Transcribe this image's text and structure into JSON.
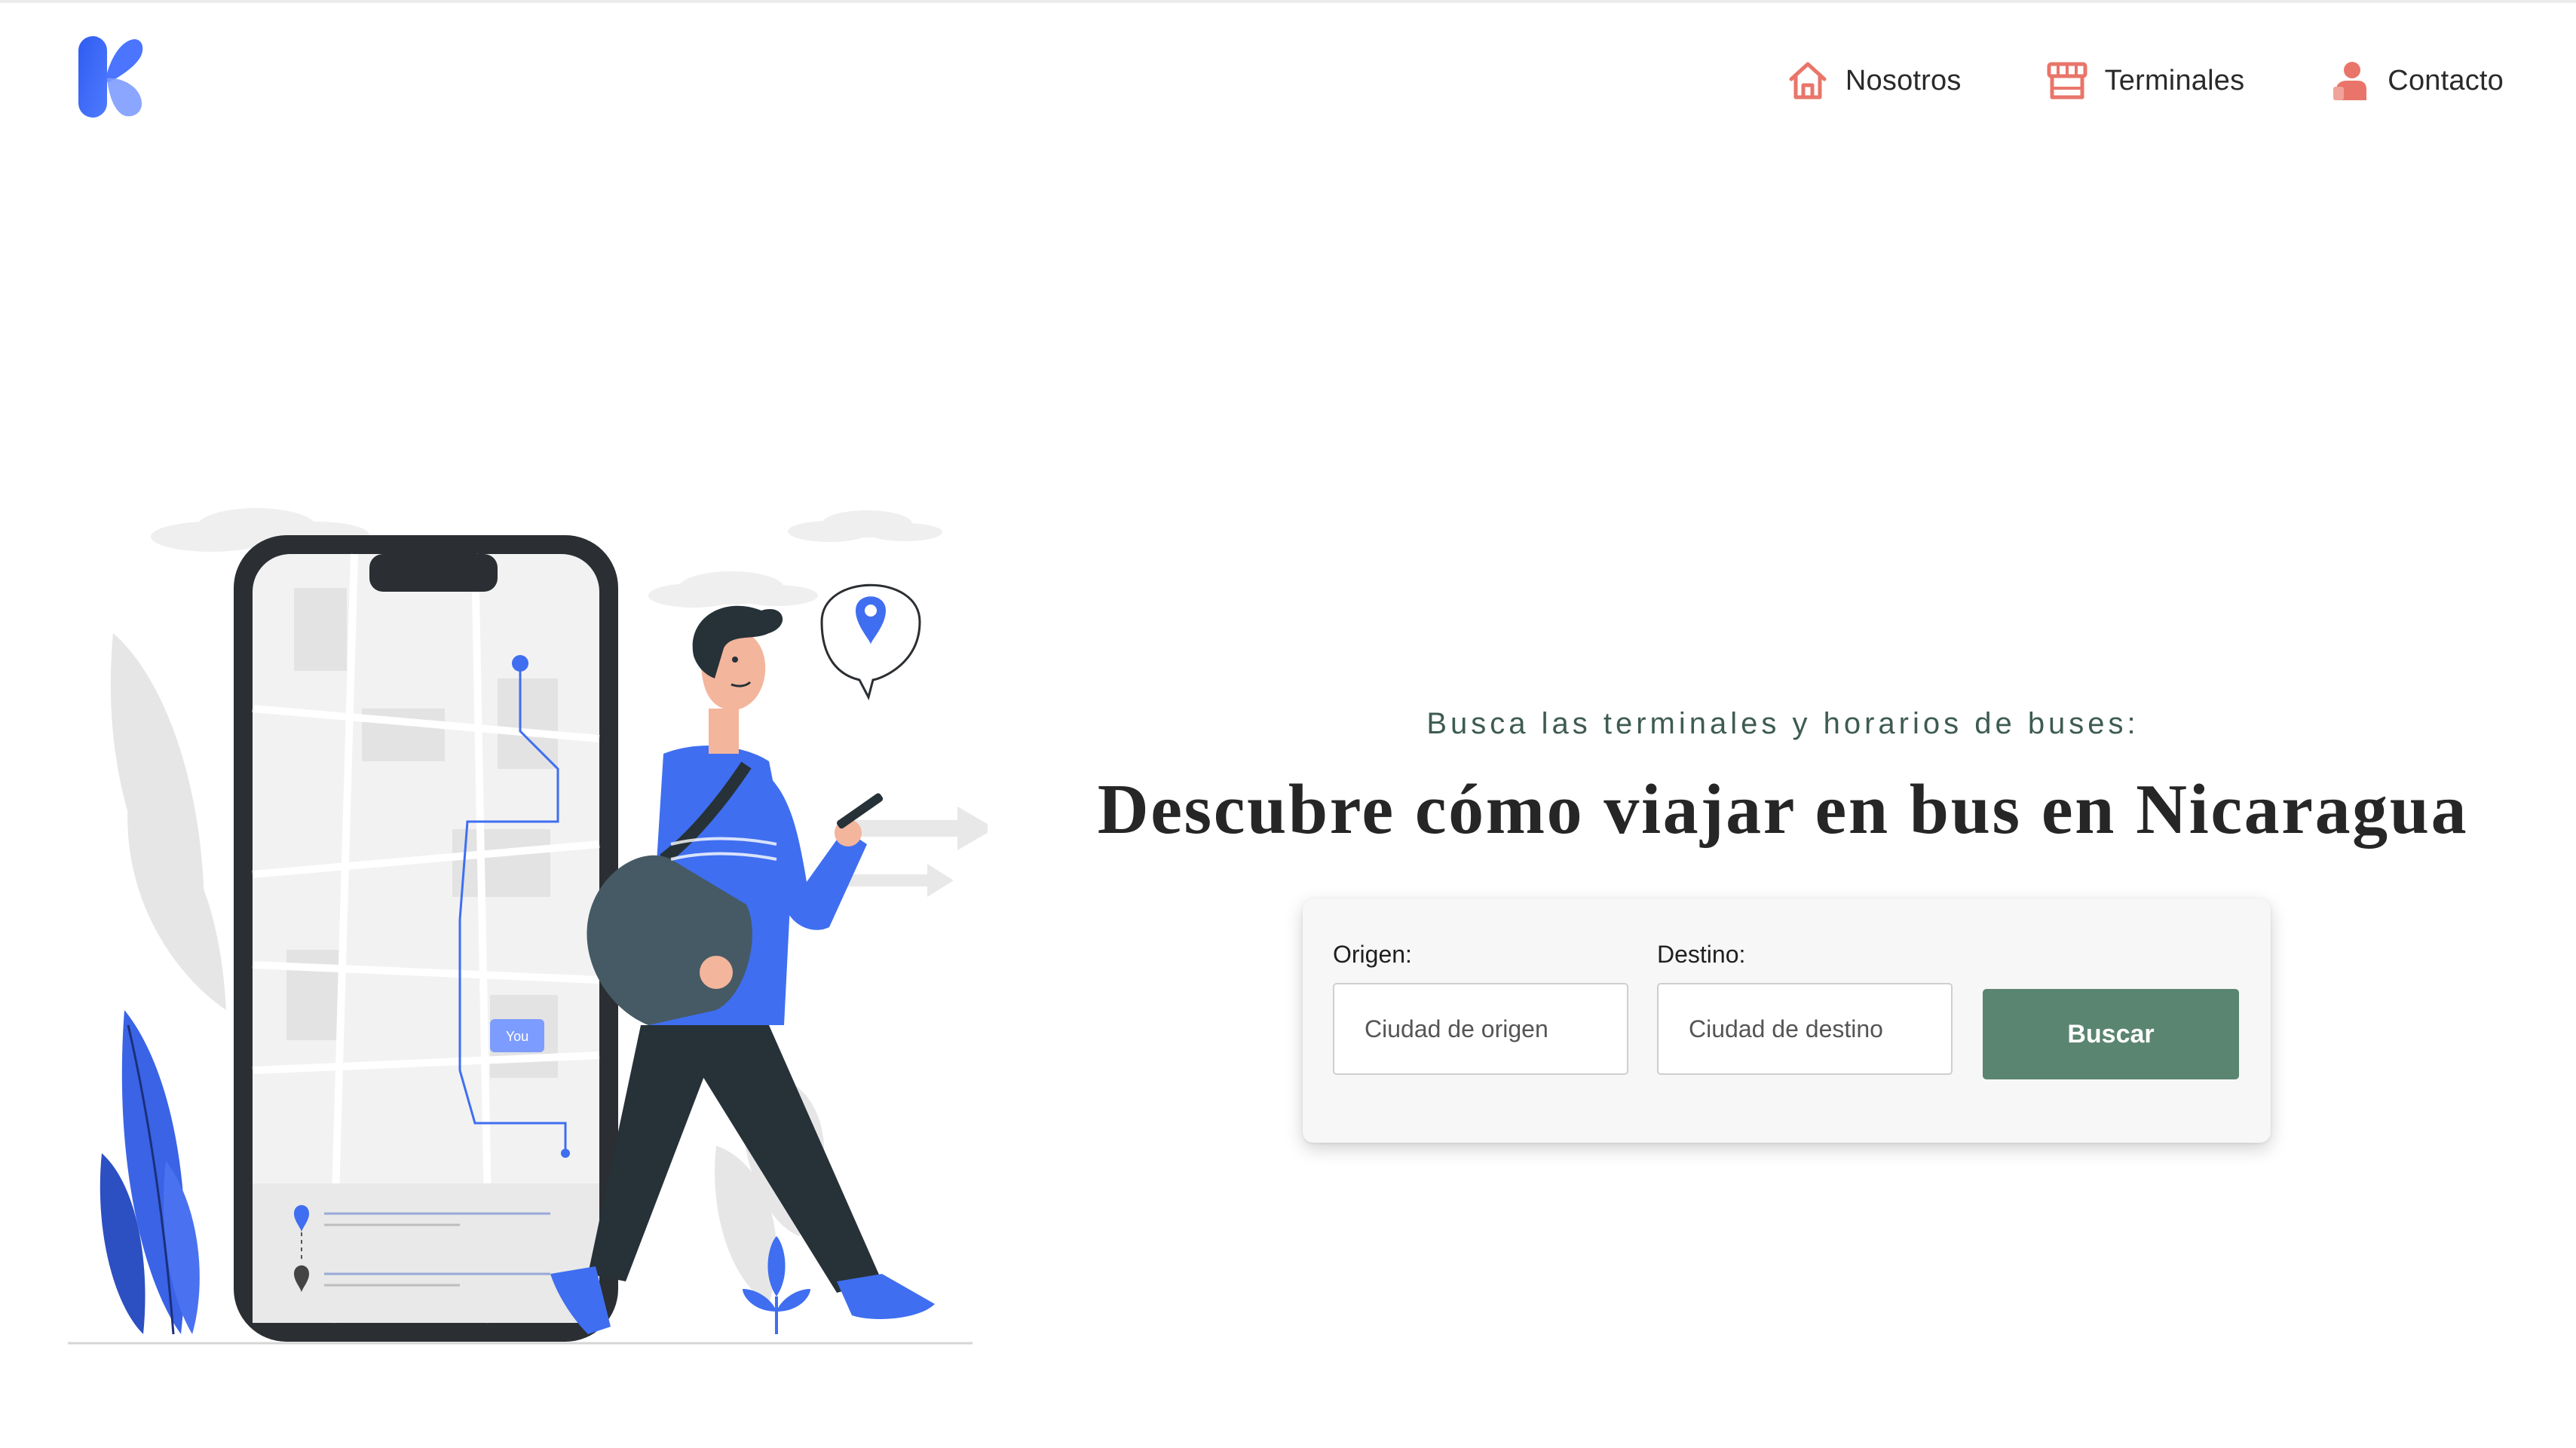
{
  "nav": {
    "items": [
      {
        "label": "Nosotros",
        "icon": "home-icon"
      },
      {
        "label": "Terminales",
        "icon": "storefront-icon"
      },
      {
        "label": "Contacto",
        "icon": "person-icon"
      }
    ]
  },
  "hero": {
    "subtitle": "Busca las terminales y horarios de buses:",
    "headline": "Descubre cómo viajar en bus en Nicaragua"
  },
  "search": {
    "origin_label": "Origen:",
    "origin_placeholder": "Ciudad de origen",
    "dest_label": "Destino:",
    "dest_placeholder": "Ciudad de destino",
    "button_label": "Buscar"
  },
  "illustration": {
    "you_label": "You"
  },
  "colors": {
    "accent": "#5a8571",
    "nav_icon": "#e9756a",
    "brand_blue": "#3f6ef0",
    "subtitle": "#3e5c50"
  }
}
